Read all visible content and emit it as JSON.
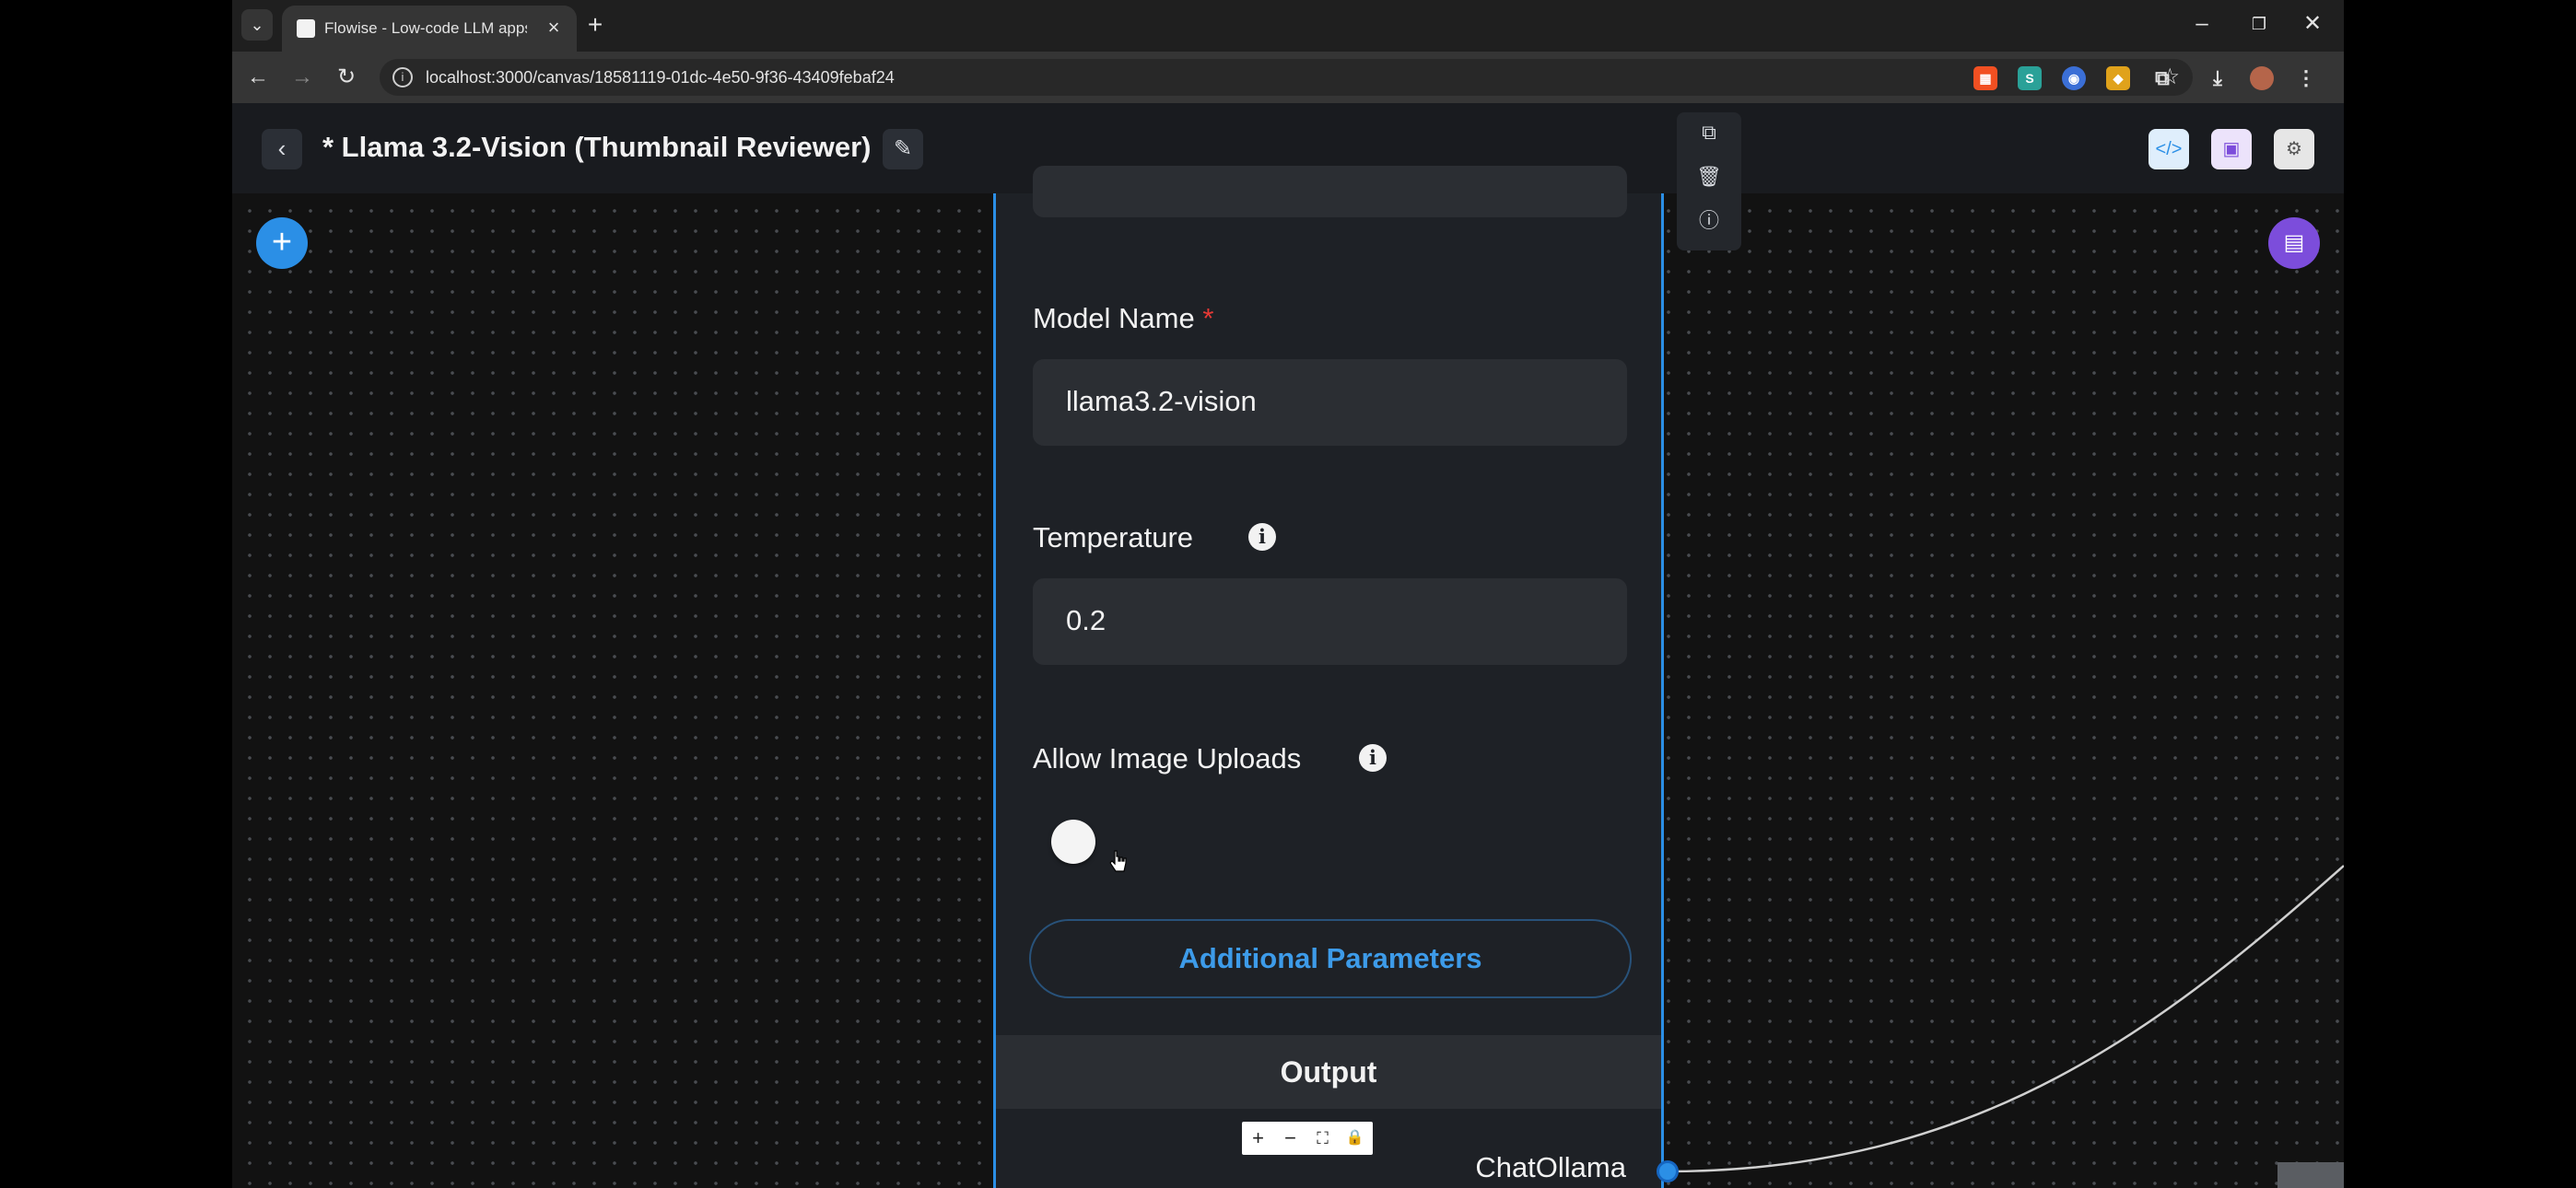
{
  "browser": {
    "tab_title": "Flowise - Low-code LLM apps b",
    "url": "localhost:3000/canvas/18581119-01dc-4e50-9f36-43409febaf24"
  },
  "header": {
    "title": "* Llama 3.2-Vision (Thumbnail Reviewer)"
  },
  "node": {
    "model_name_label": "Model Name",
    "model_name_required": "*",
    "model_name_value": "llama3.2-vision",
    "temperature_label": "Temperature",
    "temperature_value": "0.2",
    "allow_image_uploads_label": "Allow Image Uploads",
    "allow_image_uploads_enabled": false,
    "additional_params_label": "Additional Parameters",
    "output_label": "Output",
    "output_name": "ChatOllama"
  },
  "colors": {
    "accent": "#2b8fe6",
    "chat_button": "#7c4ddb",
    "required": "#e53935"
  },
  "icons": {
    "add": "plus-icon",
    "chat": "chat-icon",
    "copy": "copy-icon",
    "delete": "trash-icon",
    "info": "info-icon"
  }
}
